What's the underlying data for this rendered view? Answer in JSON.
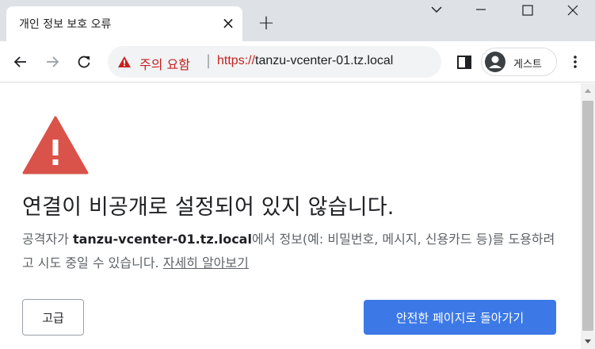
{
  "tab": {
    "title": "개인 정보 보호 오류",
    "close_glyph": "×",
    "new_tab_glyph": "+"
  },
  "window_controls": [
    "dropdown-chevron",
    "minimize",
    "maximize",
    "close"
  ],
  "omnibox": {
    "warning_label": "주의 요함",
    "separator": "|",
    "url_scheme": "https://",
    "url_host": "tanzu-vcenter-01.tz.local"
  },
  "profile": {
    "label": "게스트"
  },
  "interstitial": {
    "heading": "연결이 비공개로 설정되어 있지 않습니다.",
    "explanation_prefix": "공격자가 ",
    "explanation_host": "tanzu-vcenter-01.tz.local",
    "explanation_suffix": "에서 정보(예: 비밀번호, 메시지, 신용카드 등)를 도용하려고 시도 중일 수 있습니다. ",
    "learn_more": "자세히 알아보기",
    "advanced_button": "고급",
    "back_button": "안전한 페이지로 돌아가기"
  },
  "colors": {
    "danger": "#d93025",
    "warning_text": "#c5221f",
    "primary_button": "#3c79e6",
    "tab_strip": "#dee1e6",
    "omnibox_bg": "#f1f3f4"
  },
  "icons": {
    "danger": "warning-triangle-icon",
    "back": "arrow-left-icon",
    "forward": "arrow-right-icon",
    "reload": "reload-icon",
    "side_panel": "side-panel-icon",
    "avatar": "avatar-icon",
    "menu": "kebab-menu-icon"
  }
}
